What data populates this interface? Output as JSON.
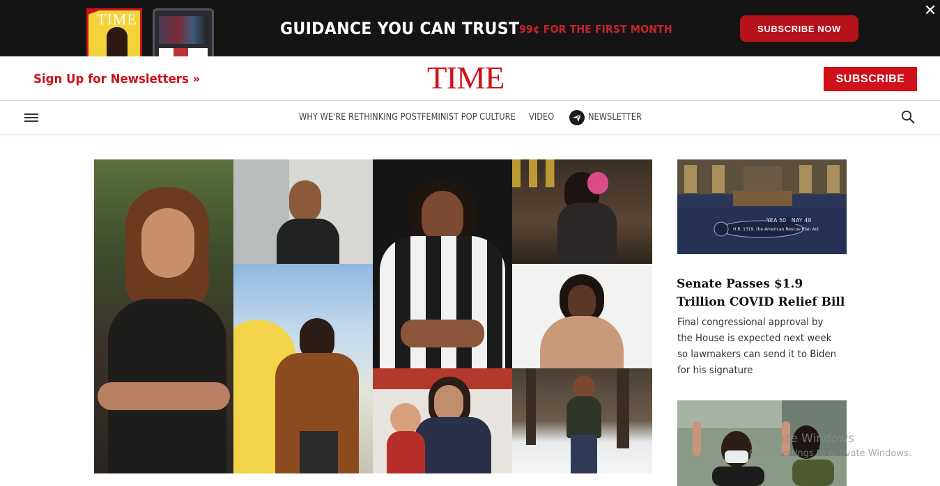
{
  "promo": {
    "mag_title": "TIME",
    "headline": "GUIDANCE YOU CAN TRUST",
    "offer": "99¢ FOR THE FIRST MONTH",
    "button_label": "SUBSCRIBE NOW",
    "close_glyph": "✕",
    "accent": "#c8242b"
  },
  "masthead": {
    "newsletter_link": "Sign Up for Newsletters »",
    "logo": "TIME",
    "subscribe_label": "SUBSCRIBE",
    "brand_color": "#d0111a"
  },
  "nav": {
    "menu_icon": "hamburger-menu-icon",
    "items": [
      {
        "label": "WHY WE'RE RETHINKING POSTFEMINIST POP CULTURE"
      },
      {
        "label": "VIDEO"
      },
      {
        "label": "NEWSLETTER",
        "icon": "paper-plane-icon"
      }
    ],
    "search_icon": "search-icon"
  },
  "sidebar": {
    "story": {
      "title": "Senate Passes $1.9 Trillion COVID Relief Bill",
      "description": "Final congressional approval by the House is expected next week so lawmakers can send it to Biden for his signature",
      "image_caption_vote": "YEA 50   NAY 49",
      "image_caption_bill": "H.R. 1319, the American Rescue Plan Act"
    }
  },
  "os_watermark": {
    "line1": "Activate Windows",
    "line2": "Go to Settings to activate Windows."
  }
}
